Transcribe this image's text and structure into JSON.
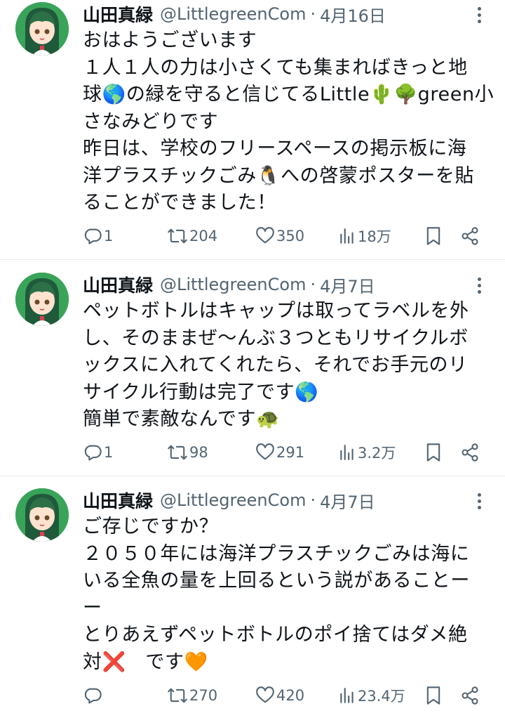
{
  "tweets": [
    {
      "name": "山田真緑",
      "handle": "@LittlegreenCom",
      "separator": "·",
      "date": "4月16日",
      "lines": [
        "おはようございます",
        "１人１人の力は小さくても集まればきっと地",
        "球🌎の緑を守ると信じてるLittle🌵🌳green小",
        "さなみどりです",
        "昨日は、学校のフリースペースの掲示板に海",
        "洋プラスチックごみ🐧への啓蒙ポスターを貼",
        "ることができました！"
      ],
      "replies": "1",
      "retweets": "204",
      "likes": "350",
      "views": "18万"
    },
    {
      "name": "山田真緑",
      "handle": "@LittlegreenCom",
      "separator": "·",
      "date": "4月7日",
      "lines": [
        "ペットボトルはキャップは取ってラベルを外",
        "し、そのままぜ〜んぶ３つともリサイクルボ",
        "ックスに入れてくれたら、それでお手元のリ",
        "サイクル行動は完了です🌎",
        "簡単で素敵なんです🐢"
      ],
      "replies": "1",
      "retweets": "98",
      "likes": "291",
      "views": "3.2万"
    },
    {
      "name": "山田真緑",
      "handle": "@LittlegreenCom",
      "separator": "·",
      "date": "4月7日",
      "lines": [
        "ご存じですか？",
        "２０５０年には海洋プラスチックごみは海に",
        "いる全魚の量を上回るという説があることー",
        "ー",
        "とりあえずペットボトルのポイ捨てはダメ絶",
        "対❌　です🧡"
      ],
      "replies": "",
      "retweets": "270",
      "likes": "420",
      "views": "23.4万"
    }
  ],
  "icons": {
    "reply": "reply-icon",
    "retweet": "retweet-icon",
    "like": "heart-icon",
    "views": "views-icon",
    "bookmark": "bookmark-icon",
    "share": "share-icon",
    "more": "more-icon"
  },
  "colors": {
    "text": "#0f1419",
    "secondary": "#536471",
    "divider": "#e6ecf0",
    "avatar_bg": "#3aa35a"
  }
}
